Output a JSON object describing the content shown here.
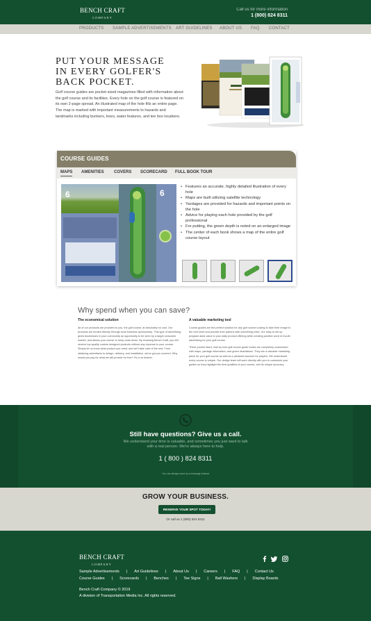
{
  "header": {
    "logo_main": "BENCH CRAFT",
    "logo_sub": "COMPANY",
    "call_label": "Call us for more information",
    "phone": "1 (800) 824 8311"
  },
  "nav": {
    "items": [
      {
        "label": "PRODUCTS"
      },
      {
        "label": "SAMPLE ADVERTISEMENTS"
      },
      {
        "label": "ART GUIDELINES"
      },
      {
        "label": "ABOUT US"
      },
      {
        "label": "FAQ"
      },
      {
        "label": "CONTACT"
      }
    ]
  },
  "hero": {
    "title_line1": "PUT YOUR MESSAGE",
    "title_line2": "IN EVERY GOLFER'S",
    "title_line3": "BACK POCKET.",
    "body": "Golf course guides are pocket sized magazines filled with information about the golf course and its facilities. Every hole on the golf course is featured on its own 2-page spread. An illustrated map of the hole fills an entire page. The map is marked with important measurements to hazards and landmarks including bunkers, trees, water features, and tee box locations."
  },
  "course_guides": {
    "title": "COURSE GUIDES",
    "tabs": [
      {
        "label": "MAPS",
        "active": true
      },
      {
        "label": "AMENITIES",
        "active": false
      },
      {
        "label": "COVERS",
        "active": false
      },
      {
        "label": "SCORECARD",
        "active": false
      },
      {
        "label": "FULL BOOK TOUR",
        "active": false
      }
    ],
    "hole_number": "6",
    "features": [
      "Features an accurate, highly detailed illustration of every hole",
      "Maps are built utilizing satellite technology",
      "Yardages are provided for hazards and important points on the hole",
      "Advice for playing each hole provided by the golf professional",
      "For putting, the green depth is noted on an enlarged image",
      "The center of each book shows a map of the entire golf course layout"
    ]
  },
  "why": {
    "title": "Why spend when you can save?",
    "left_head": "The economical solution",
    "left_text": "All of our products are provided to you, the golf course, at absolutely no cost. Our products are funded directly through local business sponsorship. This type of advertising gives businesses in your community an opportunity to be seen by a target consumer market, and allows your course to keep costs down. By choosing Bench Craft, you will receive top-quality custom designed products without any expense to your course. Simply let us know what product you need, and we'll take care of the rest. From obtaining advertisers to design, delivery, and installation, we've got you covered. Why would you pay for what we will provide for free? It's a no brainer.",
    "right_head": "A valuable marketing tool",
    "right_text_1": "Course guides are the perfect solution for any golf course looking to take their image to the next level and provide their patrons with something extra. Our easy to set up program adds value to your daily product offering while creating positive word of mouth advertising for your golf course.",
    "right_text_2": "These pocket sized, hole by hole golf course guide books are completely customized with maps, yardage information, and green illustrations. They are a valuable marketing piece for your golf course as well as a pleasant souvenir for players. We understand every course is unique. Our design team will work directly with you to customize your guides so they highlight the best qualities of your course, and its unique accuracy."
  },
  "questions": {
    "title": "Still have questions? Give us a call.",
    "subtitle": "We understand your time is valuable, and sometimes you just want to talk with a real person. We're always here to help.",
    "phone": "1 ( 800 ) 824 8311",
    "note": "You can always send us a message instead"
  },
  "grow": {
    "title": "GROW YOUR BUSINESS.",
    "button": "RESERVE YOUR SPOT TODAY!",
    "call": "Or call us 1 (800) 824 8311"
  },
  "footer": {
    "logo_main": "BENCH CRAFT",
    "logo_sub": "COMPANY",
    "links_row1": [
      "Sample Advertisements",
      "Art Guidelines",
      "About Us",
      "Careers",
      "FAQ",
      "Contact Us"
    ],
    "links_row2": [
      "Course Guides",
      "Scorecards",
      "Benches",
      "Tee Signs",
      "Ball Washers",
      "Display Boards"
    ],
    "copyright": "Bench Craft Company © 2019",
    "division": "A division of Transportation Media Inc. All rights reserved.",
    "social_icons": [
      "facebook-icon",
      "twitter-icon",
      "instagram-icon"
    ]
  },
  "colors": {
    "brand_green": "#13502f",
    "nav_bg": "#d7d6cf",
    "card_header": "#857f69"
  }
}
